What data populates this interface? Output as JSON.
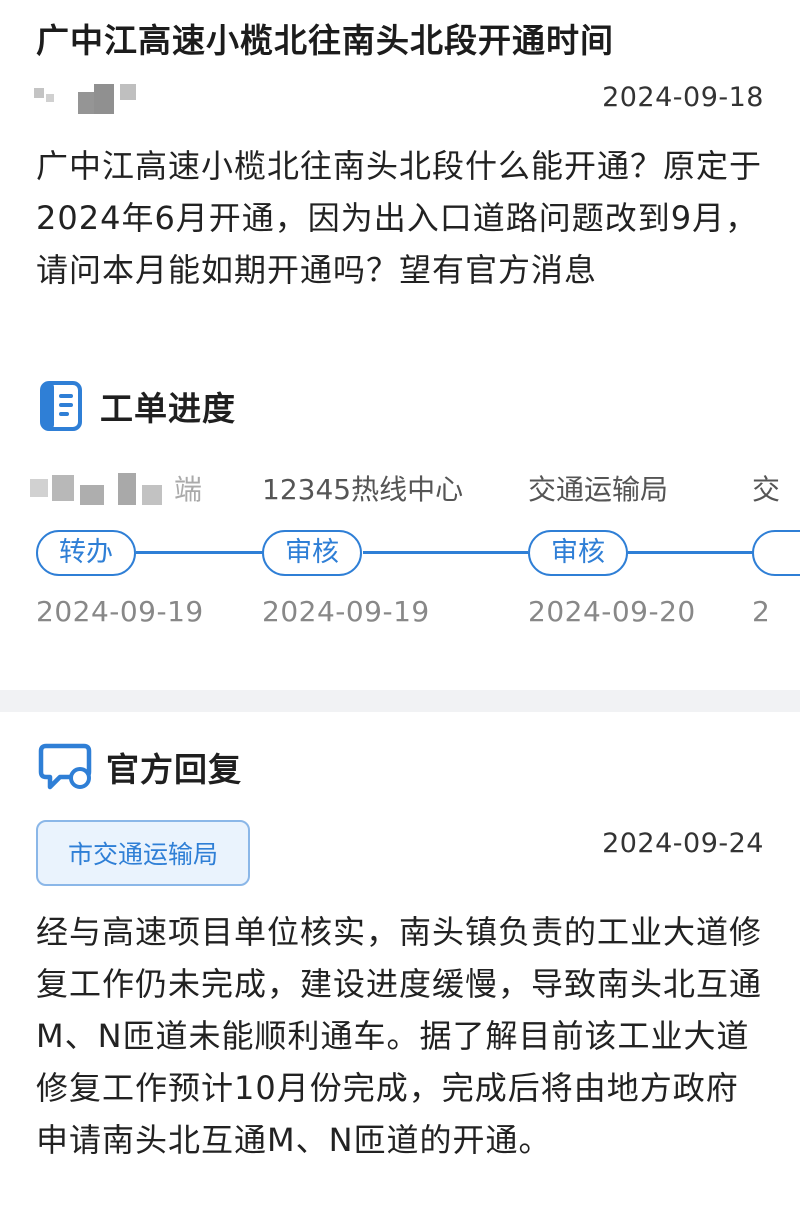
{
  "question": {
    "title": "广中江高速小榄北往南头北段开通时间",
    "date": "2024-09-18",
    "body": "广中江高速小榄北往南头北段什么能开通？原定于2024年6月开通，因为出入口道路问题改到9月，请问本月能如期开通吗？望有官方消息"
  },
  "progress": {
    "heading": "工单进度",
    "icon": "document-list-icon",
    "steps": [
      {
        "name": "端",
        "status": "转办",
        "date": "2024-09-19"
      },
      {
        "name": "12345热线中心",
        "status": "审核",
        "date": "2024-09-19"
      },
      {
        "name": "交通运输局",
        "status": "审核",
        "date": "2024-09-20"
      },
      {
        "name": "交",
        "status": "",
        "date": "2"
      }
    ]
  },
  "reply": {
    "heading": "官方回复",
    "icon": "chat-bubble-icon",
    "department": "市交通运输局",
    "date": "2024-09-24",
    "body": "经与高速项目单位核实，南头镇负责的工业大道修复工作仍未完成，建设进度缓慢，导致南头北互通M、N匝道未能顺利通车。据了解目前该工业大道修复工作预计10月份完成，完成后将由地方政府申请南头北互通M、N匝道的开通。"
  },
  "colors": {
    "accent": "#2f7fd6",
    "badge_bg": "#eaf3fd",
    "divider": "#f1f2f4"
  }
}
